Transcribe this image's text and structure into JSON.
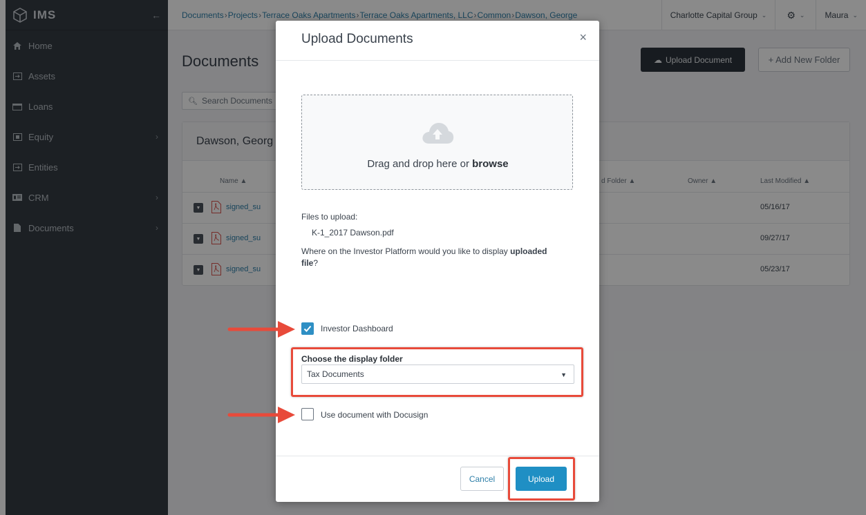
{
  "app": {
    "brand": "IMS"
  },
  "sidebar": {
    "items": [
      {
        "label": "Home",
        "icon": "home-icon"
      },
      {
        "label": "Assets",
        "icon": "assets-icon"
      },
      {
        "label": "Loans",
        "icon": "loans-icon"
      },
      {
        "label": "Equity",
        "icon": "equity-icon",
        "chevron": "›"
      },
      {
        "label": "Entities",
        "icon": "entities-icon"
      },
      {
        "label": "CRM",
        "icon": "crm-icon",
        "chevron": "›"
      },
      {
        "label": "Documents",
        "icon": "documents-icon",
        "chevron": "›"
      }
    ]
  },
  "breadcrumb": [
    "Documents",
    "Projects",
    "Terrace Oaks Apartments",
    "Terrace Oaks Apartments, LLC",
    "Common",
    "Dawson, George"
  ],
  "topbar": {
    "org": "Charlotte Capital Group",
    "user": "Maura"
  },
  "page": {
    "title": "Documents",
    "upload_button": "Upload Document",
    "new_folder_button": "+ Add New Folder",
    "search_placeholder": "Search Documents",
    "panel_title": "Dawson, Georg"
  },
  "table": {
    "columns": {
      "name": "Name ▲",
      "folder": "d Folder ▲",
      "owner": "Owner ▲",
      "modified": "Last Modified ▲"
    },
    "rows": [
      {
        "name": "signed_su",
        "date": "05/16/17"
      },
      {
        "name": "signed_su",
        "date": "09/27/17"
      },
      {
        "name": "signed_su",
        "date": "05/23/17"
      }
    ]
  },
  "modal": {
    "title": "Upload Documents",
    "close": "×",
    "dropzone_text": "Drag and drop here or ",
    "dropzone_link": "browse",
    "files_label": "Files to upload:",
    "file_name": "K-1_2017 Dawson.pdf",
    "question_prefix": "Where on the Investor Platform would you like to display ",
    "question_bold": "uploaded file",
    "question_suffix": "?",
    "investor_dashboard_label": "Investor Dashboard",
    "investor_dashboard_checked": true,
    "folder_label": "Choose the display folder",
    "folder_value": "Tax Documents",
    "docusign_label": "Use document with Docusign",
    "docusign_checked": false,
    "cancel_button": "Cancel",
    "upload_button": "Upload"
  },
  "colors": {
    "annotation": "#e84a3a",
    "primary": "#1f8fc4",
    "sidebar": "#353c44"
  }
}
